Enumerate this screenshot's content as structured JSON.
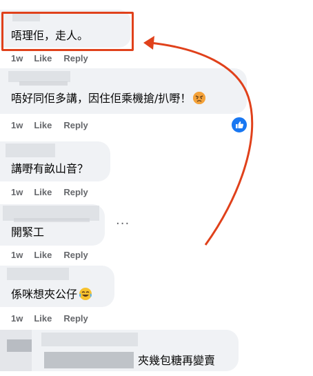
{
  "actions": {
    "time": "1w",
    "like": "Like",
    "reply": "Reply"
  },
  "comments": [
    {
      "text": "唔理佢，走人。"
    },
    {
      "text": "唔好同佢多講，因住佢乘機搶/扒嘢！",
      "emoji": "angry-face-emoji"
    },
    {
      "text": "講嘢有畝山音？"
    },
    {
      "text": "開緊工"
    },
    {
      "text": "係咪想夾公仔",
      "emoji": "laughing-tears-emoji"
    },
    {
      "text": "夾幾包糖再變賣"
    }
  ],
  "colors": {
    "annotation": "#e0411b",
    "bubble": "#f0f2f5",
    "action_text": "#65676b",
    "like_badge": "#1877f2"
  }
}
